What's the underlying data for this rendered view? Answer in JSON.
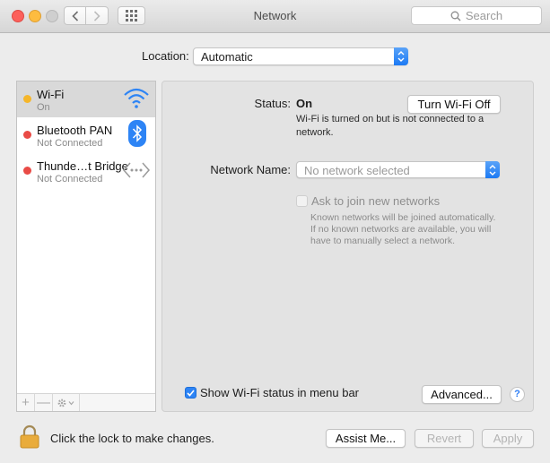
{
  "window": {
    "title": "Network",
    "search_placeholder": "Search"
  },
  "location": {
    "label": "Location:",
    "value": "Automatic"
  },
  "services": [
    {
      "name": "Wi-Fi",
      "status": "On",
      "status_color": "#f5b62a",
      "icon": "wifi-icon",
      "selected": true
    },
    {
      "name": "Bluetooth PAN",
      "status": "Not Connected",
      "status_color": "#e94b46",
      "icon": "bluetooth-icon",
      "selected": false
    },
    {
      "name": "Thunde…t Bridge",
      "status": "Not Connected",
      "status_color": "#e94b46",
      "icon": "thunderbolt-bridge-icon",
      "selected": false
    }
  ],
  "sidebar_footer": {
    "add": "+",
    "remove": "—",
    "gear": "gear-icon"
  },
  "detail": {
    "status_label": "Status:",
    "status_value": "On",
    "toggle_button": "Turn Wi-Fi Off",
    "status_description": "Wi-Fi is turned on but is not connected to a network.",
    "network_name_label": "Network Name:",
    "network_name_placeholder": "No network selected",
    "ask_join_label": "Ask to join new networks",
    "ask_join_checked": false,
    "ask_join_description": "Known networks will be joined automatically. If no known networks are available, you will have to manually select a network.",
    "show_status_label": "Show Wi-Fi status in menu bar",
    "show_status_checked": true,
    "advanced_button": "Advanced...",
    "help_button": "?"
  },
  "footer": {
    "lock_text": "Click the lock to make changes.",
    "assist_button": "Assist Me...",
    "revert_button": "Revert",
    "apply_button": "Apply"
  },
  "colors": {
    "accent": "#2d84f5",
    "background": "#ececec"
  }
}
